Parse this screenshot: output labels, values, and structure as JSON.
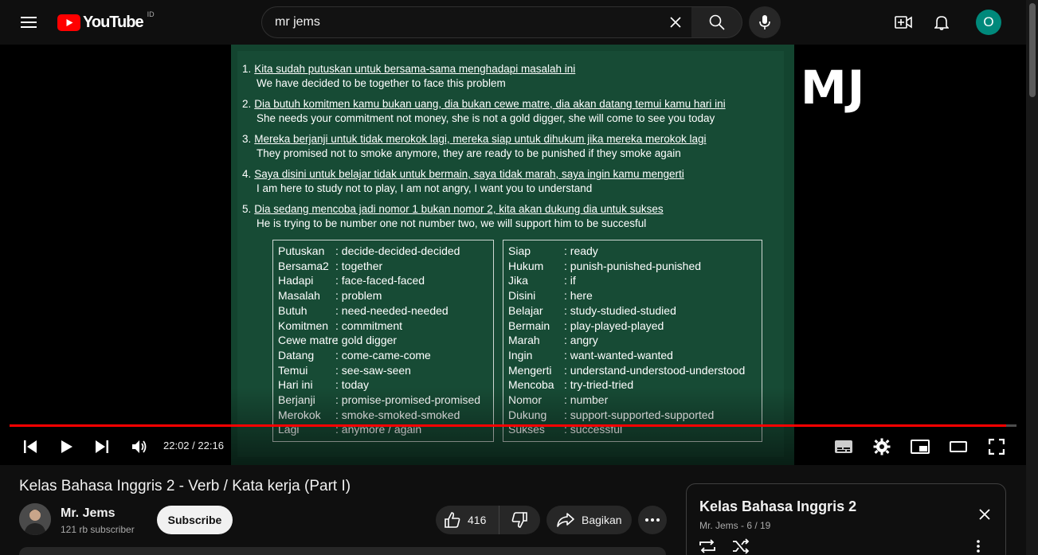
{
  "header": {
    "logo_text": "YouTube",
    "country_code": "ID",
    "search_value": "mr jems",
    "avatar_letter": "O"
  },
  "video": {
    "watermark": "MJ",
    "current_time": "22:02",
    "separator": "/",
    "duration": "22:16",
    "progress_fraction": 0.9895,
    "sentences": [
      {
        "num": "1.",
        "id": "Kita sudah putuskan untuk bersama-sama menghadapi masalah ini",
        "en": "We  have  decided  to  be  together  to  face  this problem"
      },
      {
        "num": "2.",
        "id": "Dia butuh komitmen kamu bukan uang,  dia bukan cewe matre,  dia akan datang temui kamu hari ini",
        "en": "She  needs  your commitment  not  money,  she  is not  a gold digger,  she  will  come  to see  you today"
      },
      {
        "num": "3.",
        "id": "Mereka berjanji untuk tidak merokok lagi,  mereka siap untuk dihukum   jika mereka merokok lagi",
        "en": "They promised  not  to  smoke  anymore,  they  are ready  to be  punished  if  they  smoke again"
      },
      {
        "num": "4.",
        "id": "Saya disini  untuk belajar tidak untuk bermain,  saya tidak marah,  saya ingin kamu mengerti",
        "en": "I  am  here  to  study  not  to  play,  I  am not  angry,  I  want  you  to  understand"
      },
      {
        "num": "5.",
        "id": "Dia sedang mencoba jadi nomor 1 bukan nomor 2,  kita akan dukung dia untuk sukses",
        "en": "He  is  trying  to be  number  one  not  number two,  we  will  support  him  to  be  succesful"
      }
    ],
    "vocab_left": [
      {
        "w": "Putuskan",
        "m": ": decide-decided-decided"
      },
      {
        "w": "Bersama2",
        "m": ": together"
      },
      {
        "w": "Hadapi",
        "m": ": face-faced-faced"
      },
      {
        "w": "Masalah",
        "m": ": problem"
      },
      {
        "w": "Butuh",
        "m": ": need-needed-needed"
      },
      {
        "w": "Komitmen",
        "m": ": commitment"
      },
      {
        "w": "Cewe matre",
        "m": ": gold digger"
      },
      {
        "w": "Datang",
        "m": ": come-came-come"
      },
      {
        "w": "Temui",
        "m": ": see-saw-seen"
      },
      {
        "w": "Hari ini",
        "m": ": today"
      },
      {
        "w": "Berjanji",
        "m": ": promise-promised-promised"
      },
      {
        "w": "Merokok",
        "m": ": smoke-smoked-smoked"
      },
      {
        "w": "Lagi",
        "m": ": anymore / again"
      }
    ],
    "vocab_right": [
      {
        "w": "Siap",
        "m": ": ready"
      },
      {
        "w": "Hukum",
        "m": ": punish-punished-punished"
      },
      {
        "w": "Jika",
        "m": ": if"
      },
      {
        "w": "Disini",
        "m": ": here"
      },
      {
        "w": "Belajar",
        "m": ": study-studied-studied"
      },
      {
        "w": "Bermain",
        "m": ": play-played-played"
      },
      {
        "w": "Marah",
        "m": ": angry"
      },
      {
        "w": "Ingin",
        "m": ": want-wanted-wanted"
      },
      {
        "w": "Mengerti",
        "m": ": understand-understood-understood"
      },
      {
        "w": "Mencoba",
        "m": ": try-tried-tried"
      },
      {
        "w": "Nomor",
        "m": ": number"
      },
      {
        "w": "Dukung",
        "m": ": support-supported-supported"
      },
      {
        "w": "Sukses",
        "m": ": successful"
      }
    ]
  },
  "info": {
    "title": "Kelas Bahasa Inggris 2 - Verb / Kata kerja (Part I)",
    "channel_name": "Mr. Jems",
    "subscribers": "121 rb subscriber",
    "subscribe_label": "Subscribe",
    "like_count": "416",
    "share_label": "Bagikan"
  },
  "playlist": {
    "title": "Kelas Bahasa Inggris 2",
    "subtitle": "Mr. Jems - 6 / 19"
  },
  "colors": {
    "accent_red": "#ff0000",
    "board_green": "#174b35",
    "avatar_teal": "#00897b"
  }
}
